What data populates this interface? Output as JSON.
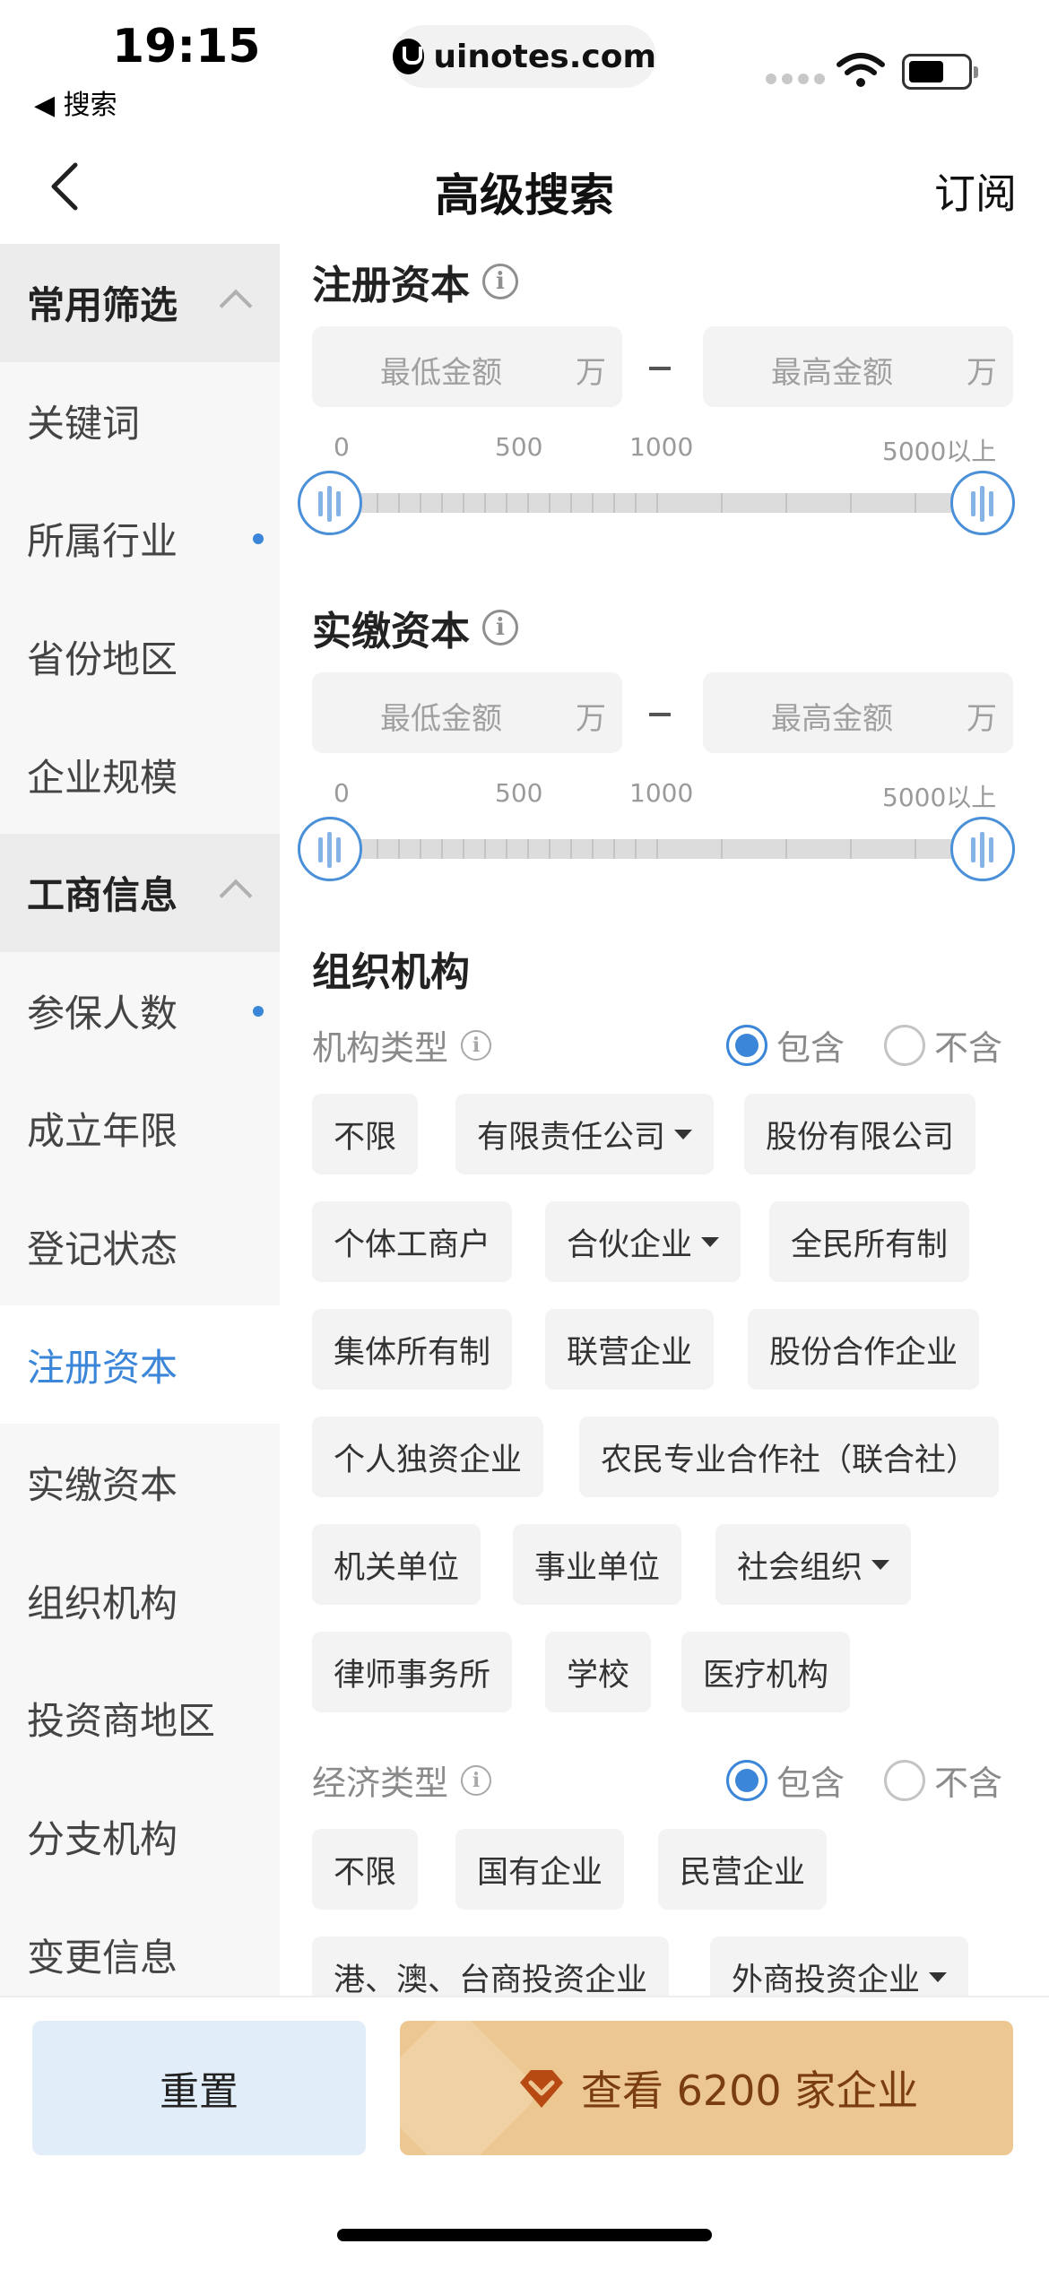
{
  "status_bar": {
    "time": "19:15",
    "back_app": "◀ 搜索",
    "url": "uinotes.com"
  },
  "nav": {
    "title": "高级搜索",
    "subscribe": "订阅"
  },
  "sidebar": {
    "items": [
      {
        "label": "常用筛选",
        "type": "group"
      },
      {
        "label": "关键词",
        "type": "item"
      },
      {
        "label": "所属行业",
        "type": "item",
        "dot": true
      },
      {
        "label": "省份地区",
        "type": "item"
      },
      {
        "label": "企业规模",
        "type": "item"
      },
      {
        "label": "工商信息",
        "type": "group"
      },
      {
        "label": "参保人数",
        "type": "item",
        "dot": true
      },
      {
        "label": "成立年限",
        "type": "item"
      },
      {
        "label": "登记状态",
        "type": "item"
      },
      {
        "label": "注册资本",
        "type": "item",
        "active": true
      },
      {
        "label": "实缴资本",
        "type": "item"
      },
      {
        "label": "组织机构",
        "type": "item"
      },
      {
        "label": "投资商地区",
        "type": "item"
      },
      {
        "label": "分支机构",
        "type": "item"
      },
      {
        "label": "变更信息",
        "type": "item"
      }
    ]
  },
  "registered_capital": {
    "title": "注册资本",
    "min_placeholder": "最低金额",
    "max_placeholder": "最高金额",
    "unit": "万",
    "ticks": [
      "0",
      "500",
      "1000",
      "5000以上"
    ]
  },
  "paid_capital": {
    "title": "实缴资本",
    "min_placeholder": "最低金额",
    "max_placeholder": "最高金额",
    "unit": "万",
    "ticks": [
      "0",
      "500",
      "1000",
      "5000以上"
    ]
  },
  "organization": {
    "title": "组织机构",
    "org_type": {
      "label": "机构类型",
      "include": "包含",
      "exclude": "不含",
      "selected": "包含",
      "chips": [
        "不限",
        "有限责任公司",
        "股份有限公司",
        "个体工商户",
        "合伙企业",
        "全民所有制",
        "集体所有制",
        "联营企业",
        "股份合作企业",
        "个人独资企业",
        "农民专业合作社（联合社）",
        "机关单位",
        "事业单位",
        "社会组织",
        "律师事务所",
        "学校",
        "医疗机构"
      ]
    },
    "econ_type": {
      "label": "经济类型",
      "include": "包含",
      "exclude": "不含",
      "selected": "包含",
      "chips": [
        "不限",
        "国有企业",
        "民营企业",
        "港、澳、台商投资企业",
        "外商投资企业"
      ]
    }
  },
  "footer": {
    "reset": "重置",
    "view": "查看 6200 家企业",
    "brand_color": "#edc791",
    "accent": "#3b86d8"
  }
}
